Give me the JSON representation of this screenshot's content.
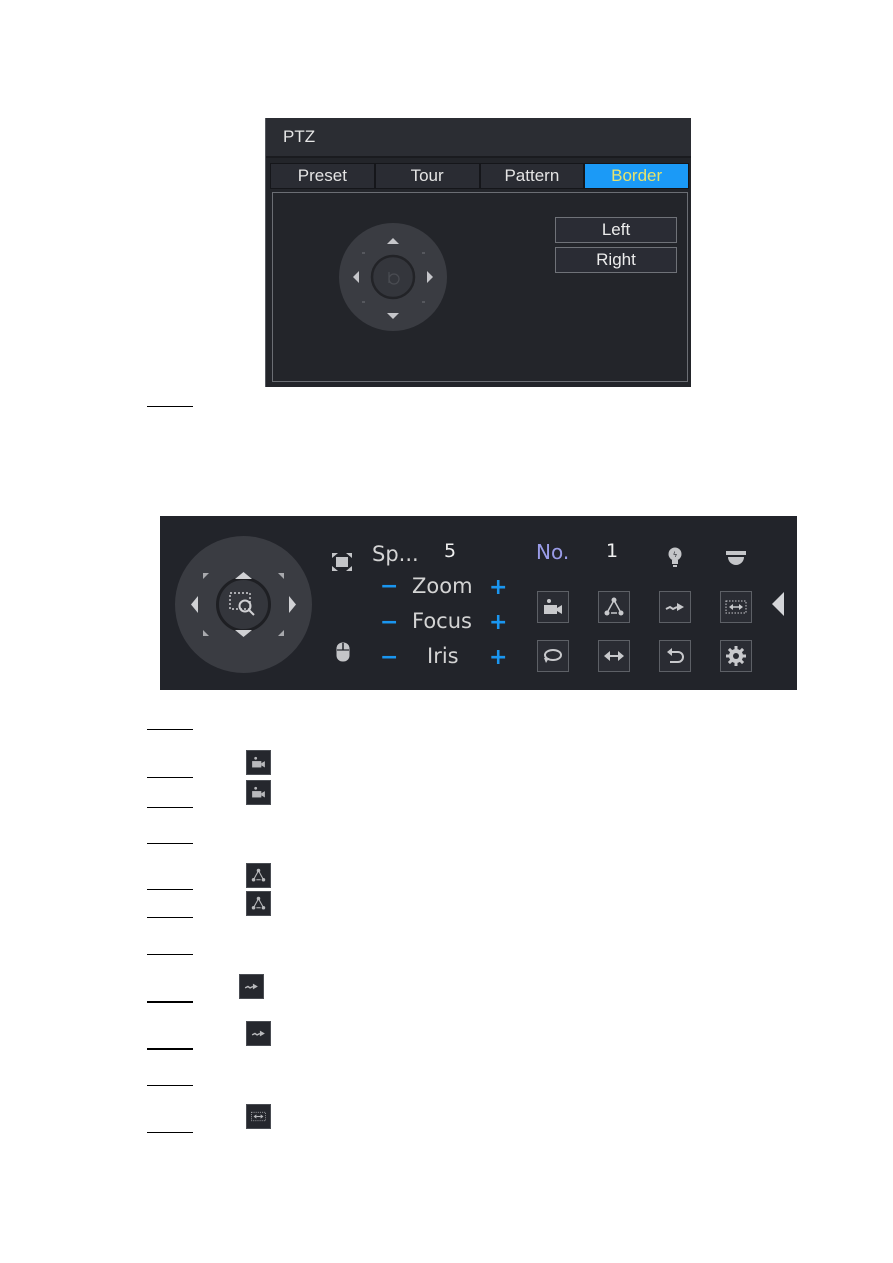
{
  "ptz_dialog": {
    "title": "PTZ",
    "tabs": [
      {
        "label": "Preset",
        "active": false
      },
      {
        "label": "Tour",
        "active": false
      },
      {
        "label": "Pattern",
        "active": false
      },
      {
        "label": "Border",
        "active": true
      }
    ],
    "buttons": {
      "left": "Left",
      "right": "Right"
    },
    "colors": {
      "active_tab_bg": "#1b9af7",
      "active_tab_text": "#e6e36d",
      "panel_bg": "#23252a"
    }
  },
  "ptz_bar": {
    "speed_label": "Sp...",
    "speed_value": "5",
    "zoom_label": "Zoom",
    "focus_label": "Focus",
    "iris_label": "Iris",
    "minus": "−",
    "plus": "+",
    "no_label": "No.",
    "no_value": "1",
    "icons_row1": [
      "preset-camera-icon",
      "tour-icon",
      "pattern-icon",
      "border-icon"
    ],
    "icons_row2": [
      "rotate-icon",
      "pan-icon",
      "flip-icon",
      "settings-icon"
    ],
    "colors": {
      "accent": "#1a96f0",
      "bar_bg": "#22242a",
      "no_label": "#9a9ce8"
    }
  },
  "document": {
    "inline_icons": [
      "preset-camera-icon",
      "preset-camera-icon",
      "tour-icon",
      "tour-icon",
      "pattern-icon",
      "pattern-icon",
      "border-icon"
    ]
  }
}
